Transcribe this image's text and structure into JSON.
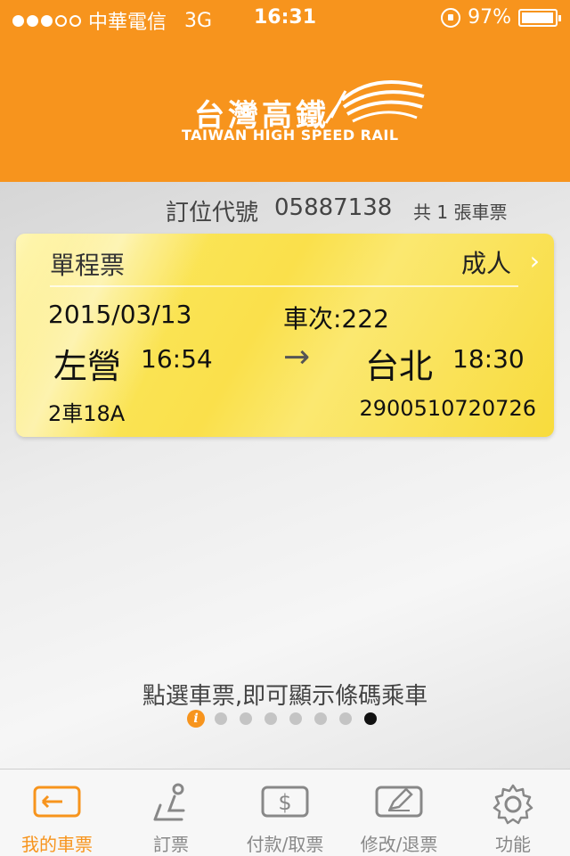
{
  "status_bar": {
    "carrier": "中華電信",
    "network": "3G",
    "time": "16:31",
    "battery": "97%",
    "battery_level": 0.97,
    "signal_bars": 3
  },
  "header": {
    "logo_cn": "台灣高鐵",
    "logo_en": "TAIWAN HIGH SPEED RAIL",
    "brand_color": "#f7941d"
  },
  "booking": {
    "label": "訂位代號",
    "code": "05887138",
    "ticket_count": "共 1 張車票"
  },
  "ticket": {
    "type": "單程票",
    "passenger": "成人",
    "date": "2015/03/13",
    "train": "車次:222",
    "from_station": "左營",
    "departure_time": "16:54",
    "arrow": "→",
    "to_station": "台北",
    "arrival_time": "18:30",
    "seat": "2車18A",
    "ticket_number": "2900510720726"
  },
  "hint": "點選車票,即可顯示條碼乘車",
  "pager": {
    "info_glyph": "i",
    "total_dots": 8,
    "current_index": 7
  },
  "tabbar": {
    "items": [
      {
        "label": "我的車票",
        "icon": "my-tickets-icon",
        "active": true
      },
      {
        "label": "訂票",
        "icon": "seat-icon",
        "active": false
      },
      {
        "label": "付款/取票",
        "icon": "payment-icon",
        "active": false
      },
      {
        "label": "修改/退票",
        "icon": "edit-icon",
        "active": false
      },
      {
        "label": "功能",
        "icon": "gear-icon",
        "active": false
      }
    ]
  }
}
